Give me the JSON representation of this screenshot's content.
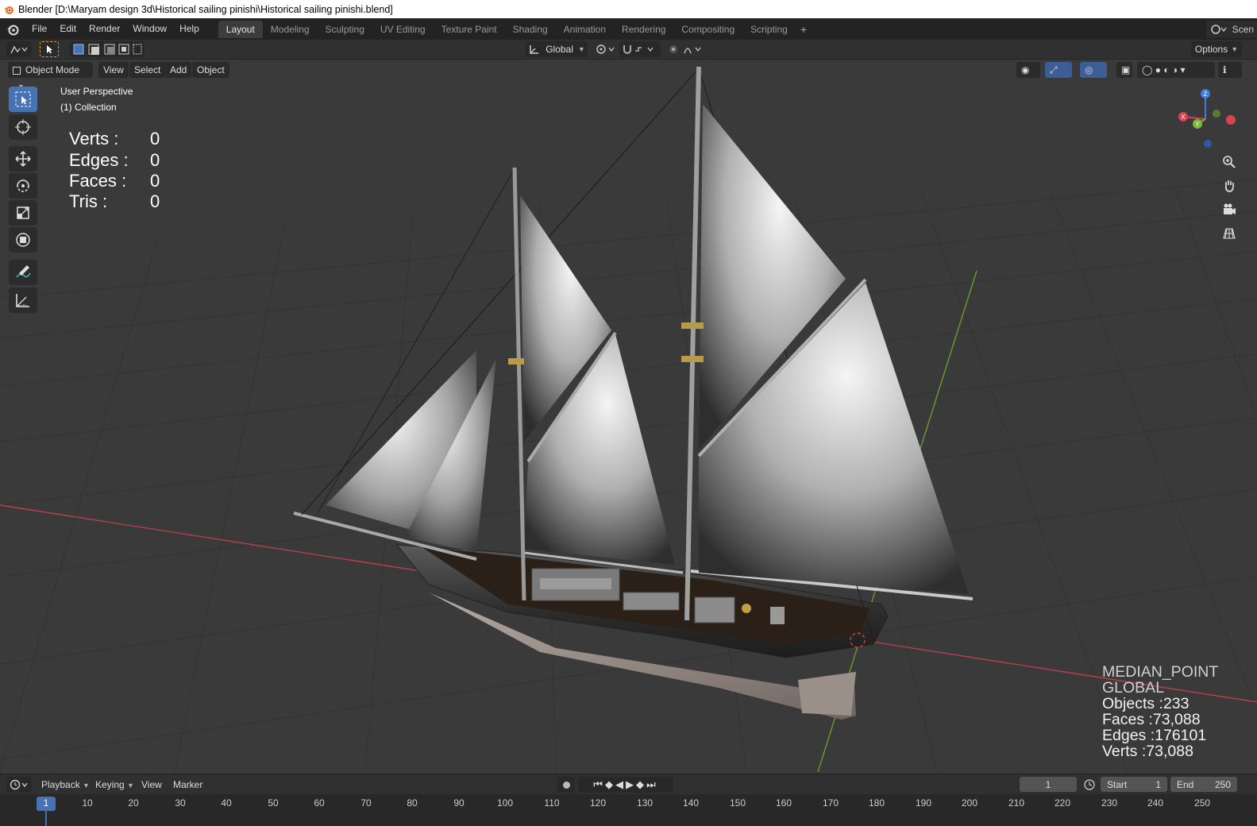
{
  "window": {
    "title": "Blender [D:\\Maryam design 3d\\Historical sailing pinishi\\Historical sailing pinishi.blend]"
  },
  "menu": [
    "File",
    "Edit",
    "Render",
    "Window",
    "Help"
  ],
  "workspaces": [
    "Layout",
    "Modeling",
    "Sculpting",
    "UV Editing",
    "Texture Paint",
    "Shading",
    "Animation",
    "Rendering",
    "Compositing",
    "Scripting"
  ],
  "active_workspace": "Layout",
  "scene_label": "Scen",
  "toolheader": {
    "orientation": "Global",
    "options_label": "Options"
  },
  "viewport_header": {
    "mode": "Object Mode",
    "menus": [
      "View",
      "Select",
      "Add",
      "Object"
    ]
  },
  "viewport": {
    "perspective": "User Perspective",
    "collection": "(1) Collection",
    "selection_stats": [
      {
        "label": "Verts :",
        "value": "0"
      },
      {
        "label": "Edges :",
        "value": "0"
      },
      {
        "label": "Faces :",
        "value": "0"
      },
      {
        "label": "Tris :",
        "value": "0"
      }
    ],
    "scene_stats": {
      "pivot": "MEDIAN_POINT",
      "orientation": "GLOBAL",
      "objects": "Objects :233",
      "faces": "Faces :73,088",
      "edges": "Edges :176101",
      "verts": "Verts :73,088"
    },
    "gizmo_axes": {
      "x": "X",
      "y": "Y",
      "z": "Z"
    }
  },
  "timeline": {
    "menus": [
      "Playback",
      "Keying",
      "View",
      "Marker"
    ],
    "current_frame": "1",
    "start_label": "Start",
    "start": "1",
    "end_label": "End",
    "end": "250",
    "ruler": [
      "1",
      "10",
      "20",
      "30",
      "40",
      "50",
      "60",
      "70",
      "80",
      "90",
      "100",
      "110",
      "120",
      "130",
      "140",
      "150",
      "160",
      "170",
      "180",
      "190",
      "200",
      "210",
      "220",
      "230",
      "240",
      "250"
    ]
  },
  "colors": {
    "accent": "#4772b3",
    "x_axis": "#d9434f",
    "y_axis": "#7ab83a",
    "z_axis": "#3d7ee0",
    "grid_bg": "#3a3a3a"
  }
}
